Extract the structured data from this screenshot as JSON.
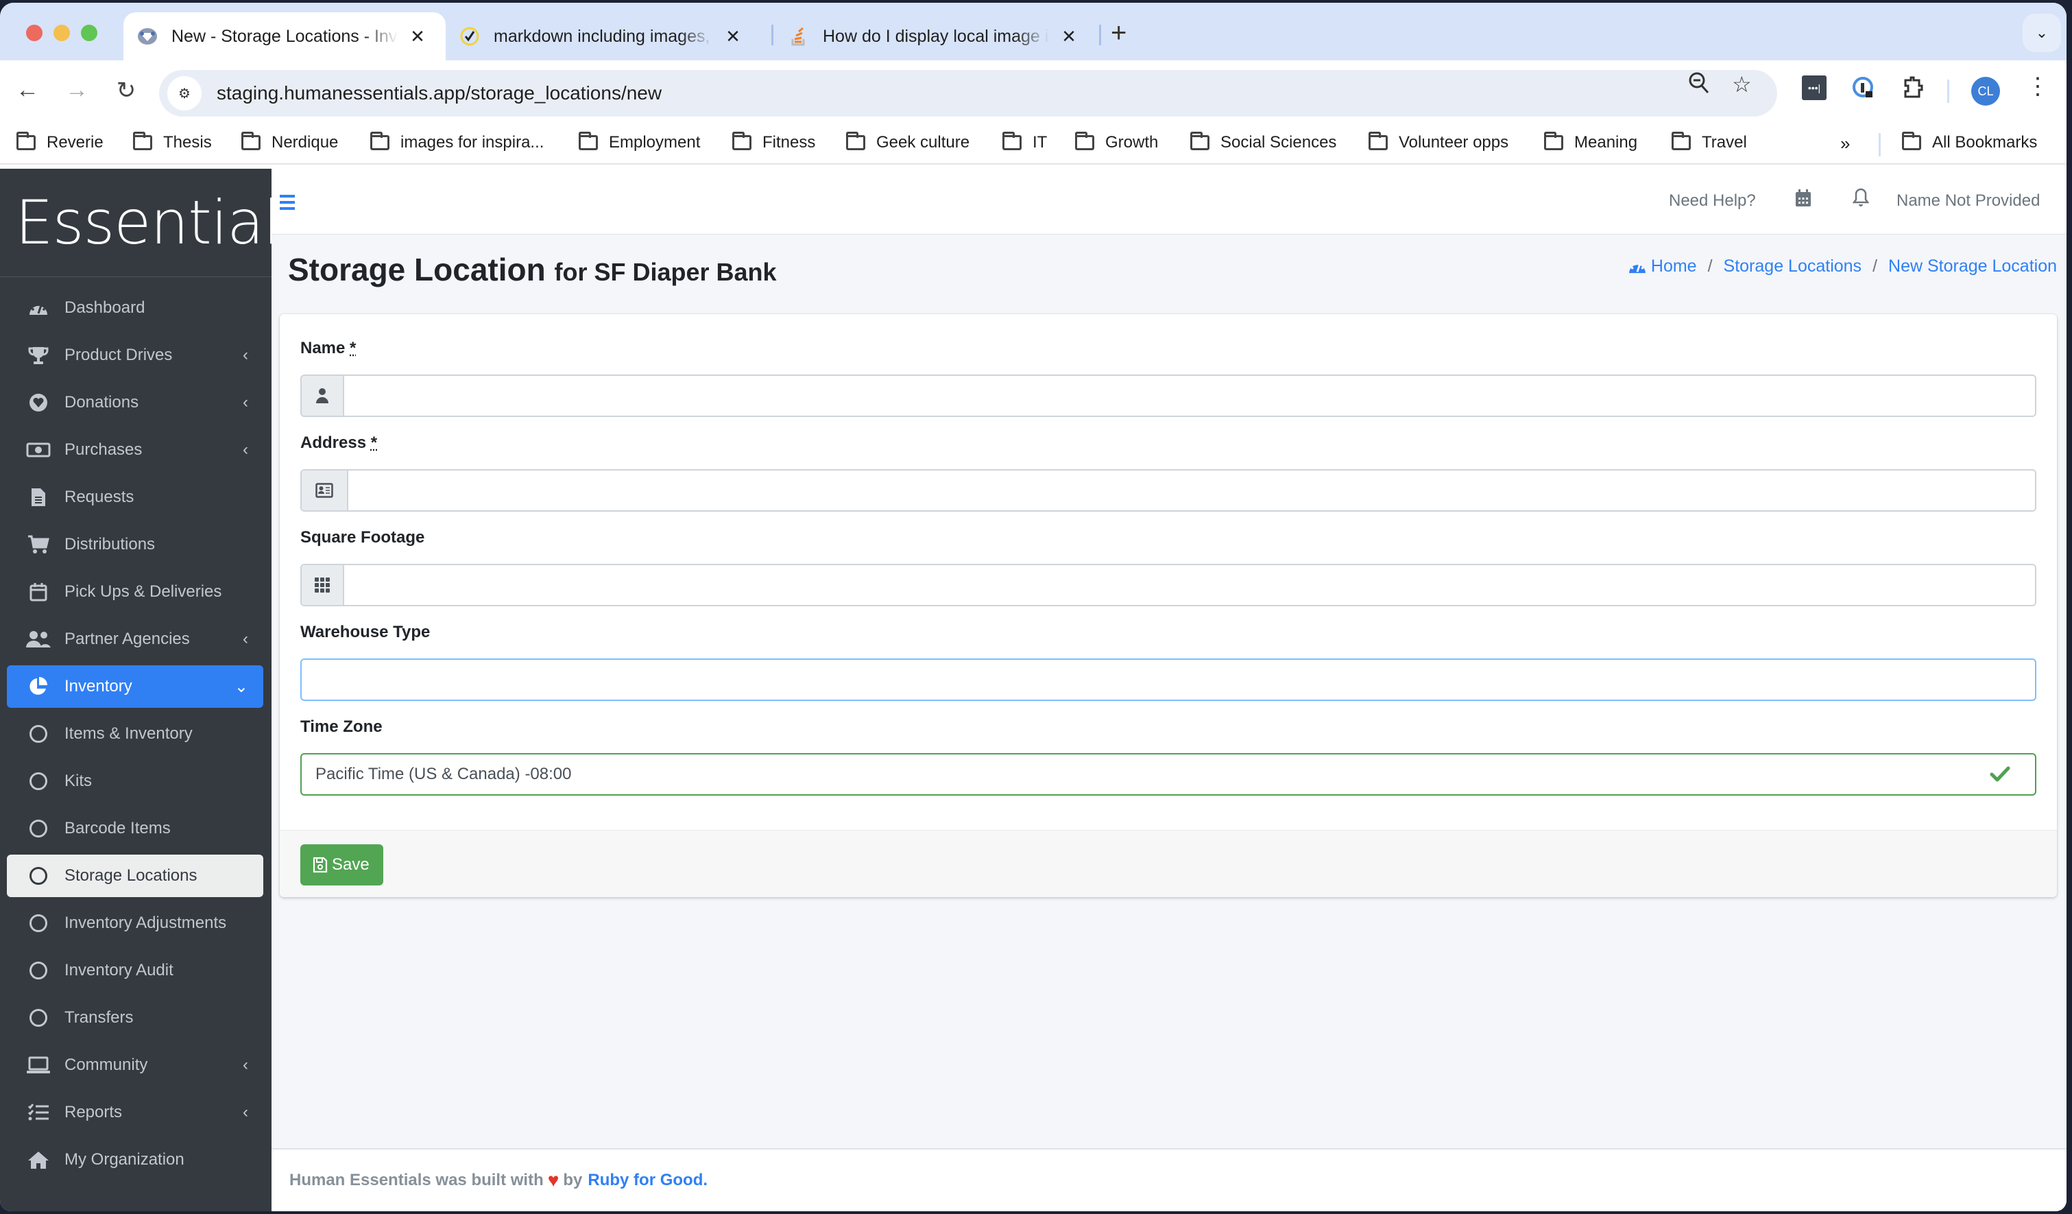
{
  "browser": {
    "tabs": [
      {
        "title": "New - Storage Locations - Inventory",
        "active": true,
        "favicon": "diaper-logo-icon"
      },
      {
        "title": "markdown including images, and",
        "active": false,
        "favicon": "check-circle-icon"
      },
      {
        "title": "How do I display local image in",
        "active": false,
        "favicon": "stackoverflow-icon"
      }
    ],
    "url": "staging.humanessentials.app/storage_locations/new",
    "profile_initials": "CL",
    "bookmarks": [
      "Reverie",
      "Thesis",
      "Nerdique",
      "images for inspira...",
      "Employment",
      "Fitness",
      "Geek culture",
      "IT",
      "Growth",
      "Social Sciences",
      "Volunteer opps",
      "Meaning",
      "Travel"
    ],
    "all_bookmarks_label": "All Bookmarks"
  },
  "app": {
    "brand": "Essentials",
    "topnav": {
      "help": "Need Help?",
      "user": "Name Not Provided"
    },
    "sidebar": {
      "items": [
        {
          "label": "Dashboard",
          "icon": "dashboard-icon",
          "chevron": false
        },
        {
          "label": "Product Drives",
          "icon": "trophy-icon",
          "chevron": true
        },
        {
          "label": "Donations",
          "icon": "heart-circle-icon",
          "chevron": true
        },
        {
          "label": "Purchases",
          "icon": "money-bill-icon",
          "chevron": true
        },
        {
          "label": "Requests",
          "icon": "file-icon",
          "chevron": false
        },
        {
          "label": "Distributions",
          "icon": "cart-icon",
          "chevron": false
        },
        {
          "label": "Pick Ups & Deliveries",
          "icon": "calendar-icon",
          "chevron": false
        },
        {
          "label": "Partner Agencies",
          "icon": "users-icon",
          "chevron": true
        },
        {
          "label": "Inventory",
          "icon": "pie-chart-icon",
          "chevron": true,
          "state": "expanded"
        },
        {
          "label": "Items & Inventory",
          "icon": "circle-icon",
          "sub": true
        },
        {
          "label": "Kits",
          "icon": "circle-icon",
          "sub": true
        },
        {
          "label": "Barcode Items",
          "icon": "circle-icon",
          "sub": true
        },
        {
          "label": "Storage Locations",
          "icon": "circle-icon",
          "sub": true,
          "state": "current"
        },
        {
          "label": "Inventory Adjustments",
          "icon": "circle-icon",
          "sub": true
        },
        {
          "label": "Inventory Audit",
          "icon": "circle-icon",
          "sub": true
        },
        {
          "label": "Transfers",
          "icon": "circle-icon",
          "sub": true
        },
        {
          "label": "Community",
          "icon": "laptop-icon",
          "chevron": true
        },
        {
          "label": "Reports",
          "icon": "list-check-icon",
          "chevron": true
        },
        {
          "label": "My Organization",
          "icon": "home-icon",
          "chevron": false
        }
      ]
    },
    "page": {
      "title": "Storage Location",
      "subtitle": "for SF Diaper Bank",
      "breadcrumb": [
        "Home",
        "Storage Locations",
        "New Storage Location"
      ]
    },
    "form": {
      "name": {
        "label": "Name",
        "required_mark": "*",
        "value": ""
      },
      "address": {
        "label": "Address",
        "required_mark": "*",
        "value": ""
      },
      "square_footage": {
        "label": "Square Footage",
        "value": ""
      },
      "warehouse_type": {
        "label": "Warehouse Type",
        "value": ""
      },
      "time_zone": {
        "label": "Time Zone",
        "value": "Pacific Time (US & Canada) -08:00"
      },
      "save_label": "Save"
    },
    "footer": {
      "text_before": "Human Essentials was built with",
      "text_by": "by",
      "link": "Ruby for Good",
      "period": "."
    },
    "colors": {
      "sidebar_bg": "#343a40",
      "accent": "#3080f4",
      "success": "#52a552",
      "heart": "#e2352b"
    }
  }
}
